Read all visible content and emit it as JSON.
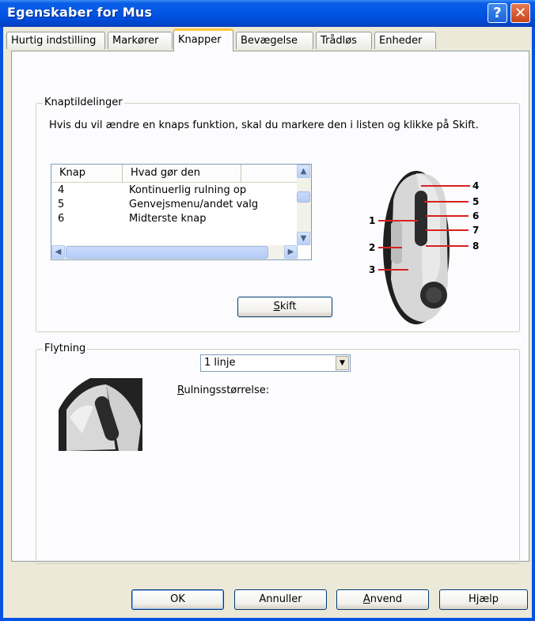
{
  "window": {
    "title": "Egenskaber for Mus",
    "help_glyph": "?",
    "close_glyph": "✕"
  },
  "tabs": [
    {
      "label": "Hurtig indstilling"
    },
    {
      "label": "Markører"
    },
    {
      "label": "Knapper",
      "active": true
    },
    {
      "label": "Bevægelse"
    },
    {
      "label": "Trådløs"
    },
    {
      "label": "Enheder"
    }
  ],
  "button_assignments": {
    "group_title": "Knaptildelinger",
    "description": "Hvis du vil ændre en knaps funktion, skal du markere den i listen og klikke på Skift.",
    "columns": [
      "Knap",
      "Hvad gør den"
    ],
    "rows": [
      {
        "knap": "4",
        "function": "Kontinuerlig rulning op"
      },
      {
        "knap": "5",
        "function": "Genvejsmenu/andet valg"
      },
      {
        "knap": "6",
        "function": "Midterste knap"
      }
    ],
    "change_button_accesskey": "S",
    "change_button_rest": "kift",
    "callouts": [
      "1",
      "2",
      "3",
      "4",
      "5",
      "6",
      "7",
      "8"
    ]
  },
  "scrolling": {
    "group_title": "Flytning",
    "label_accesskey": "R",
    "label_rest": "ulningsstørrelse:",
    "selected": "1 linje"
  },
  "footer": {
    "ok": "OK",
    "cancel": "Annuller",
    "apply_accesskey": "A",
    "apply_rest": "nvend",
    "help": "Hjælp"
  },
  "colors": {
    "title_blue": "#0054e3",
    "face": "#ece9d8",
    "tab_highlight": "#ffc83c",
    "callout_red": "#d82020"
  },
  "icons": {
    "scroll_up": "chevron-up-icon",
    "scroll_down": "chevron-down-icon",
    "scroll_left": "chevron-left-icon",
    "scroll_right": "chevron-right-icon"
  }
}
